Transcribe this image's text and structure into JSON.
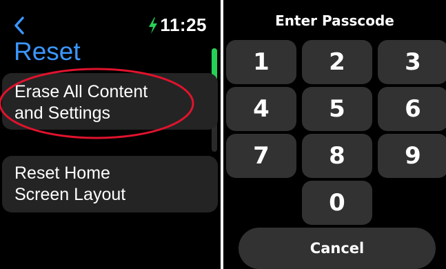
{
  "left_screen": {
    "back_icon": "chevron-left-icon",
    "charging_icon": "lightning-bolt-icon",
    "time": "11:25",
    "title": "Reset",
    "menu_items": [
      {
        "line1": "Erase All Content",
        "line2": "and Settings"
      },
      {
        "line1": "Reset Home",
        "line2": "Screen Layout"
      }
    ],
    "highlight_color": "#e0132d"
  },
  "right_screen": {
    "title": "Enter Passcode",
    "keys": [
      "1",
      "2",
      "3",
      "4",
      "5",
      "6",
      "7",
      "8",
      "9",
      "0"
    ],
    "cancel_label": "Cancel"
  },
  "colors": {
    "accent_blue": "#3b97ff",
    "charging_green": "#27d158",
    "key_background": "#323232",
    "menu_background": "#242424"
  }
}
